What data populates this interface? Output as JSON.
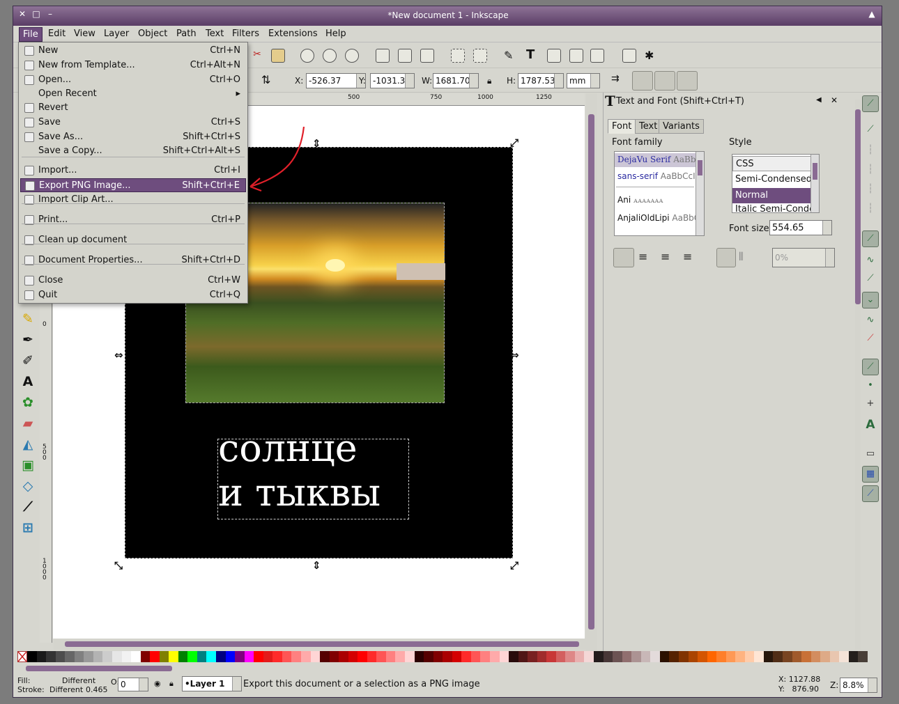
{
  "window": {
    "title": "*New document 1 - Inkscape"
  },
  "menubar": [
    "File",
    "Edit",
    "View",
    "Layer",
    "Object",
    "Path",
    "Text",
    "Filters",
    "Extensions",
    "Help"
  ],
  "file_menu": [
    {
      "label": "New",
      "shortcut": "Ctrl+N",
      "icon": "new-doc-icon"
    },
    {
      "label": "New from Template...",
      "shortcut": "Ctrl+Alt+N",
      "icon": "template-icon"
    },
    {
      "label": "Open...",
      "shortcut": "Ctrl+O",
      "icon": "open-folder-icon"
    },
    {
      "label": "Open Recent",
      "shortcut": "▸",
      "icon": ""
    },
    {
      "label": "Revert",
      "shortcut": "",
      "icon": "revert-icon"
    },
    {
      "label": "Save",
      "shortcut": "Ctrl+S",
      "icon": "save-icon"
    },
    {
      "label": "Save As...",
      "shortcut": "Shift+Ctrl+S",
      "icon": "save-as-icon"
    },
    {
      "label": "Save a Copy...",
      "shortcut": "Shift+Ctrl+Alt+S",
      "icon": ""
    },
    {
      "label": "Import...",
      "shortcut": "Ctrl+I",
      "icon": "import-icon"
    },
    {
      "label": "Export PNG Image...",
      "shortcut": "Shift+Ctrl+E",
      "icon": "export-png-icon"
    },
    {
      "label": "Import Clip Art...",
      "shortcut": "",
      "icon": "clipart-icon"
    },
    {
      "label": "Print...",
      "shortcut": "Ctrl+P",
      "icon": "print-icon"
    },
    {
      "label": "Clean up document",
      "shortcut": "",
      "icon": "cleanup-icon"
    },
    {
      "label": "Document Properties...",
      "shortcut": "Shift+Ctrl+D",
      "icon": "document-properties-icon"
    },
    {
      "label": "Close",
      "shortcut": "Ctrl+W",
      "icon": "close-icon"
    },
    {
      "label": "Quit",
      "shortcut": "Ctrl+Q",
      "icon": "quit-icon"
    }
  ],
  "tool_controls": {
    "x_label": "X:",
    "x": "-526.37",
    "y_label": "Y:",
    "y": "-1031.3",
    "w_label": "W:",
    "w": "1681.70",
    "h_label": "H:",
    "h": "1787.53",
    "unit": "mm"
  },
  "ruler": {
    "h_ticks": [
      "500",
      "750",
      "1000",
      "1250"
    ],
    "v_ticks": [
      "0",
      "500",
      "1000"
    ]
  },
  "canvas": {
    "text_line1": "солнце",
    "text_line2": "и тыквы"
  },
  "text_panel": {
    "title": "Text and Font (Shift+Ctrl+T)",
    "tabs": [
      "Font",
      "Text",
      "Variants"
    ],
    "font_family_label": "Font family",
    "fonts": [
      {
        "name": "DejaVu Serif",
        "sample": "AaBbC"
      },
      {
        "name": "sans-serif",
        "sample": "AaBbCcI"
      },
      {
        "name": "Ani",
        "sample": "ꭺꭺꭺꭺꭺꭺꭺ"
      },
      {
        "name": "AnjaliOldLipi",
        "sample": "AaBbC"
      }
    ],
    "style_label": "Style",
    "styles": [
      "CSS",
      "Semi-Condensed",
      "Normal",
      "Italic Semi-Conden"
    ],
    "font_size_label": "Font size",
    "font_size": "554.65",
    "spacing": "0%"
  },
  "status": {
    "fill_label": "Fill:",
    "fill_value": "Different",
    "stroke_label": "Stroke:",
    "stroke_value": "Different",
    "stroke_width": "0.465",
    "opacity": "0",
    "layer": "•Layer 1",
    "message": "Export this document or a selection as a PNG image",
    "x_coord": "X: 1127.88",
    "y_coord": "Y:   876.90",
    "zoom_label": "Z:",
    "zoom": "8.8%"
  }
}
